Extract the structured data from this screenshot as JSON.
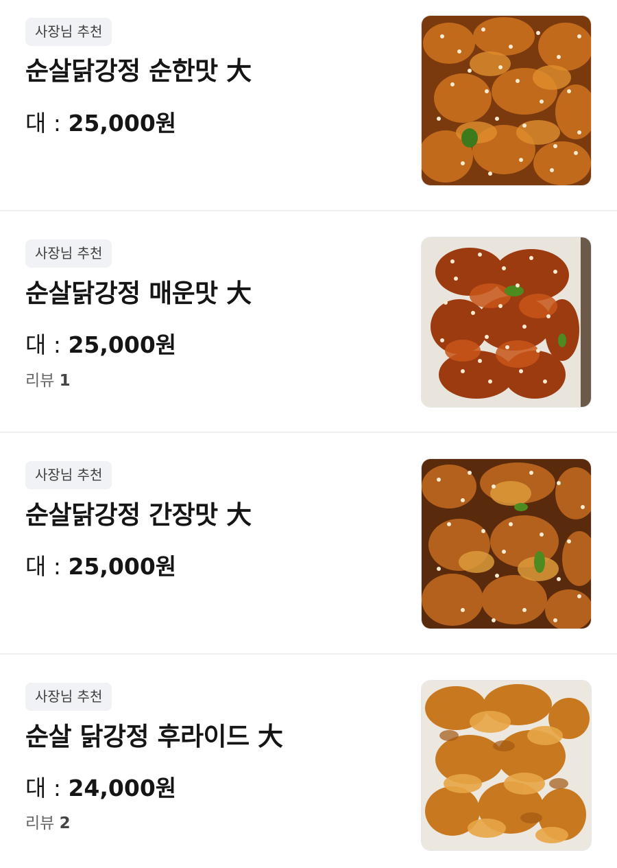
{
  "menu": {
    "items": [
      {
        "badge": "사장님 추천",
        "name": "순살닭강정 순한맛 大",
        "price_label": "대 : ",
        "price": "25,000원",
        "review_label": "",
        "review_count": "",
        "image": "sweet-fried-chicken-photo"
      },
      {
        "badge": "사장님 추천",
        "name": "순살닭강정 매운맛 大",
        "price_label": "대 : ",
        "price": "25,000원",
        "review_label": "리뷰 ",
        "review_count": "1",
        "image": "spicy-fried-chicken-photo"
      },
      {
        "badge": "사장님 추천",
        "name": "순살닭강정 간장맛 大",
        "price_label": "대 : ",
        "price": "25,000원",
        "review_label": "",
        "review_count": "",
        "image": "soy-fried-chicken-photo"
      },
      {
        "badge": "사장님 추천",
        "name": "순살 닭강정 후라이드 大",
        "price_label": "대 : ",
        "price": "24,000원",
        "review_label": "리뷰 ",
        "review_count": "2",
        "image": "plain-fried-chicken-photo"
      }
    ]
  },
  "colors": {
    "badge_bg": "#f1f2f5",
    "divider": "#f0f0f2",
    "text_primary": "#151515",
    "text_secondary": "#666666"
  }
}
